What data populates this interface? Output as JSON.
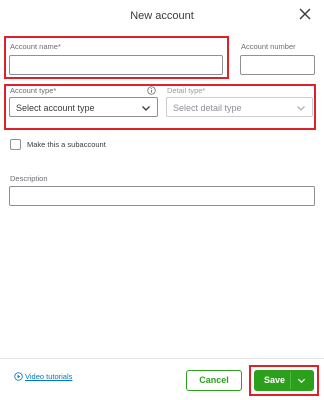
{
  "dialog": {
    "title": "New account"
  },
  "form": {
    "account_name": {
      "label": "Account name*",
      "value": ""
    },
    "account_number": {
      "label": "Account number",
      "value": ""
    },
    "account_type": {
      "label": "Account type*",
      "value": "Select account type"
    },
    "detail_type": {
      "label": "Detail type*",
      "value": "Select detail type"
    },
    "subaccount": {
      "label": "Make this a subaccount",
      "checked": false
    },
    "description": {
      "label": "Description",
      "value": ""
    }
  },
  "footer": {
    "video_link": "Video tutorials",
    "cancel_label": "Cancel",
    "save_label": "Save"
  },
  "colors": {
    "accent_green": "#2ca01c",
    "highlight_red": "#e0212a",
    "link_blue": "#0077c5"
  },
  "icons": [
    "close-icon",
    "info-icon",
    "chevron-down-icon",
    "play-circle-icon"
  ]
}
